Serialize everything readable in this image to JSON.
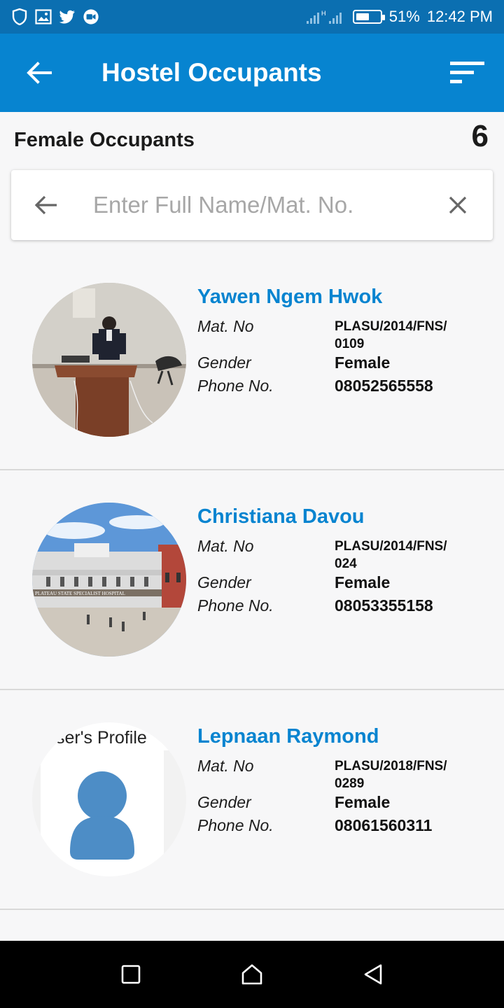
{
  "status_bar": {
    "battery": "51%",
    "time": "12:42 PM",
    "icons": [
      "shield-icon",
      "gallery-icon",
      "twitter-icon",
      "video-call-icon",
      "signal-icon",
      "battery-icon"
    ]
  },
  "app_bar": {
    "title": "Hostel Occupants",
    "back_icon": "arrow-left-icon",
    "menu_icon": "filter-icon"
  },
  "header": {
    "title": "Female Occupants",
    "count": "6"
  },
  "search": {
    "placeholder": "Enter Full Name/Mat. No.",
    "value": ""
  },
  "labels": {
    "mat": "Mat. No",
    "gender": "Gender",
    "phone": "Phone No."
  },
  "occupants": [
    {
      "name": "Yawen Ngem Hwok",
      "mat_line1": "PLASU/2014/FNS/",
      "mat_line2": "0109",
      "gender": "Female",
      "phone": "08052565558",
      "photo": "speaker-at-podium"
    },
    {
      "name": "Christiana Davou",
      "mat_line1": "PLASU/2014/FNS/",
      "mat_line2": "024",
      "gender": "Female",
      "phone": "08053355158",
      "photo": "hospital-building",
      "photo_sign": "PLATEAU STATE SPECIALIST HOSPITAL"
    },
    {
      "name": "Lepnaan Raymond",
      "mat_line1": "PLASU/2018/FNS/",
      "mat_line2": "0289",
      "gender": "Female",
      "phone": "08061560311",
      "photo": "default-user-profile",
      "photo_caption": "ser's Profile"
    }
  ],
  "colors": {
    "status_bar": "#0b6fb1",
    "app_bar": "#0784d0",
    "name_accent": "#0784d0",
    "background": "#f7f7f8"
  }
}
